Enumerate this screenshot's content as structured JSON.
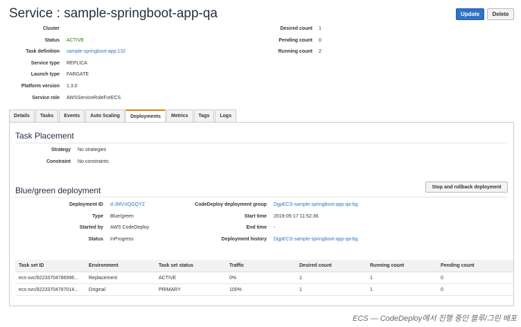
{
  "header": {
    "title": "Service : sample-springboot-app-qa",
    "update_label": "Update",
    "delete_label": "Delete"
  },
  "details_left": [
    {
      "label": "Cluster",
      "value": ""
    },
    {
      "label": "Status",
      "value": "ACTIVE"
    },
    {
      "label": "Task definition",
      "value": "sample-springboot-app:132"
    },
    {
      "label": "Service type",
      "value": "REPLICA"
    },
    {
      "label": "Launch type",
      "value": "FARGATE"
    },
    {
      "label": "Platform version",
      "value": "1.3.0"
    },
    {
      "label": "Service role",
      "value": "AWSServiceRoleForECS"
    }
  ],
  "details_right": [
    {
      "label": "Desired count",
      "value": "1"
    },
    {
      "label": "Pending count",
      "value": "0"
    },
    {
      "label": "Running count",
      "value": "2"
    }
  ],
  "tabs": [
    "Details",
    "Tasks",
    "Events",
    "Auto Scaling",
    "Deployments",
    "Metrics",
    "Tags",
    "Logs"
  ],
  "active_tab": "Deployments",
  "task_placement": {
    "title": "Task Placement",
    "strategy_label": "Strategy",
    "strategy_value": "No strategies",
    "constraint_label": "Constraint",
    "constraint_value": "No constraints"
  },
  "bluegreen": {
    "title": "Blue/green deployment",
    "stop_label": "Stop and rollback deployment",
    "left": [
      {
        "label": "Deployment ID",
        "value": "d-JMVXQGQYZ"
      },
      {
        "label": "Type",
        "value": "Blue/green"
      },
      {
        "label": "Started by",
        "value": "AWS CodeDeploy"
      },
      {
        "label": "Status",
        "value": "InProgress"
      }
    ],
    "right": [
      {
        "label": "CodeDeploy deployment group",
        "value": "DgpECS-sample-springboot-app-qa-bg"
      },
      {
        "label": "Start time",
        "value": "2019-05-17 11:52:36"
      },
      {
        "label": "End time",
        "value": "-"
      },
      {
        "label": "Deployment history",
        "value": "DgpECS-sample-springboot-app-qa-bg"
      }
    ]
  },
  "taskset_table": {
    "columns": [
      "Task set ID",
      "Environment",
      "Task set status",
      "Traffic",
      "Desired count",
      "Running count",
      "Pending count"
    ],
    "rows": [
      [
        "ecs-svc/92233704786996...",
        "Replacement",
        "ACTIVE",
        "0%",
        "1",
        "1",
        "0"
      ],
      [
        "ecs-svc/92233704787014...",
        "Original",
        "PRIMARY",
        "100%",
        "1",
        "1",
        "0"
      ]
    ]
  },
  "caption": "ECS — CodeDeploy에서 진행 중인 블루/그린 배포",
  "colors": {
    "accent": "#2e73c6",
    "active_tab": "#e07b00",
    "status_green": "#1d8102"
  }
}
